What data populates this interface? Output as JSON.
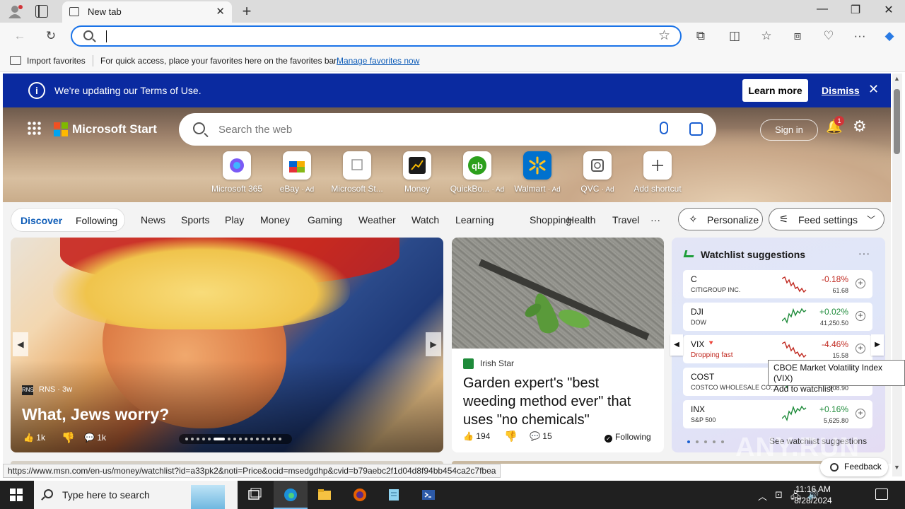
{
  "browser": {
    "tab_title": "New tab",
    "tab_close": "✕",
    "new_tab": "+",
    "window_controls": {
      "minimize": "—",
      "maximize": "❐",
      "close": "✕"
    },
    "toolbar_icons": {
      "back": "←",
      "refresh": "↻",
      "extensions": "⧉",
      "split": "◫",
      "favorites": "☆",
      "collections": "⧈",
      "performance": "♡",
      "more": "···",
      "copilot": "◆"
    },
    "address": {
      "value": "",
      "placeholder": ""
    }
  },
  "favorites_bar": {
    "import": "Import favorites",
    "message": "For quick access, place your favorites here on the favorites bar.",
    "manage": "Manage favorites now"
  },
  "banner": {
    "info_icon": "i",
    "text": "We're updating our Terms of Use.",
    "learn_more": "Learn more",
    "dismiss": "Dismiss",
    "close": "✕"
  },
  "header": {
    "brand": "Microsoft Start",
    "search_placeholder": "Search the web",
    "sign_in": "Sign in",
    "notifications_count": "1",
    "bell_icon": "🔔",
    "settings_icon": "⚙"
  },
  "quick_links": [
    {
      "label": "Microsoft 365",
      "ad": "",
      "icon": "m365-icon",
      "color": "#7a5af5"
    },
    {
      "label": "eBay",
      "ad": "· Ad",
      "icon": "ebay-icon",
      "color": "#e53238"
    },
    {
      "label": "Microsoft St...",
      "ad": "",
      "icon": "broken-image-icon",
      "color": "#999999"
    },
    {
      "label": "Money",
      "ad": "",
      "icon": "money-icon",
      "color": "#1b1b1b"
    },
    {
      "label": "QuickBo...",
      "ad": "· Ad",
      "icon": "quickbooks-icon",
      "color": "#2ca01c"
    },
    {
      "label": "Walmart",
      "ad": "· Ad",
      "icon": "walmart-icon",
      "color": "#0071ce"
    },
    {
      "label": "QVC",
      "ad": "· Ad",
      "icon": "qvc-icon",
      "color": "#555555"
    },
    {
      "label": "Add shortcut",
      "ad": "",
      "icon": "plus-icon",
      "color": "#333333"
    }
  ],
  "nav": {
    "discover": "Discover",
    "following": "Following",
    "items": [
      "News",
      "Sports",
      "Play",
      "Money",
      "Gaming",
      "Weather",
      "Watch",
      "Learning",
      "Shopping",
      "Health",
      "Travel"
    ],
    "more": "···",
    "personalize": "Personalize",
    "feed_settings": "Feed settings"
  },
  "hero_story": {
    "source_icon": "RNS",
    "source": "RNS · 3w",
    "headline": "What, Jews worry?",
    "likes": "1k",
    "comments": "1k",
    "carousel_dots": 16,
    "active_dot": 5
  },
  "story_card": {
    "source": "Irish Star",
    "headline": "Garden expert's \"best weeding method ever\" that uses \"no chemicals\"",
    "likes": "194",
    "comments": "15",
    "following": "Following"
  },
  "watchlist": {
    "title": "Watchlist suggestions",
    "more": "···",
    "stocks": [
      {
        "symbol": "C",
        "name": "CITIGROUP INC.",
        "change": "-0.18%",
        "price": "61.68",
        "trend": "down"
      },
      {
        "symbol": "DJI",
        "name": "DOW",
        "change": "+0.02%",
        "price": "41,250.50",
        "trend": "up"
      },
      {
        "symbol": "VIX",
        "name": "Dropping fast",
        "change": "-4.46%",
        "price": "15.58",
        "trend": "down",
        "flag": "🔻"
      },
      {
        "symbol": "COST",
        "name": "COSTCO WHOLESALE CO...",
        "change": "",
        "price": "908.90",
        "trend": "up"
      },
      {
        "symbol": "INX",
        "name": "S&P 500",
        "change": "+0.16%",
        "price": "5,625.80",
        "trend": "up"
      }
    ],
    "see_all": "See watchlist suggestions",
    "tooltip_line1": "CBOE Market Volatility Index (VIX)",
    "tooltip_line2": "Add to watchlist"
  },
  "status_url": "https://www.msn.com/en-us/money/watchlist?id=a33pk2&noti=Price&ocid=msedgdhp&cvid=b79aebc2f1d04d8f94bb454ca2c7fbea",
  "feedback": "Feedback",
  "watermark": "ANY.RUN",
  "taskbar": {
    "search_placeholder": "Type here to search",
    "time": "11:16 AM",
    "date": "8/28/2024"
  }
}
